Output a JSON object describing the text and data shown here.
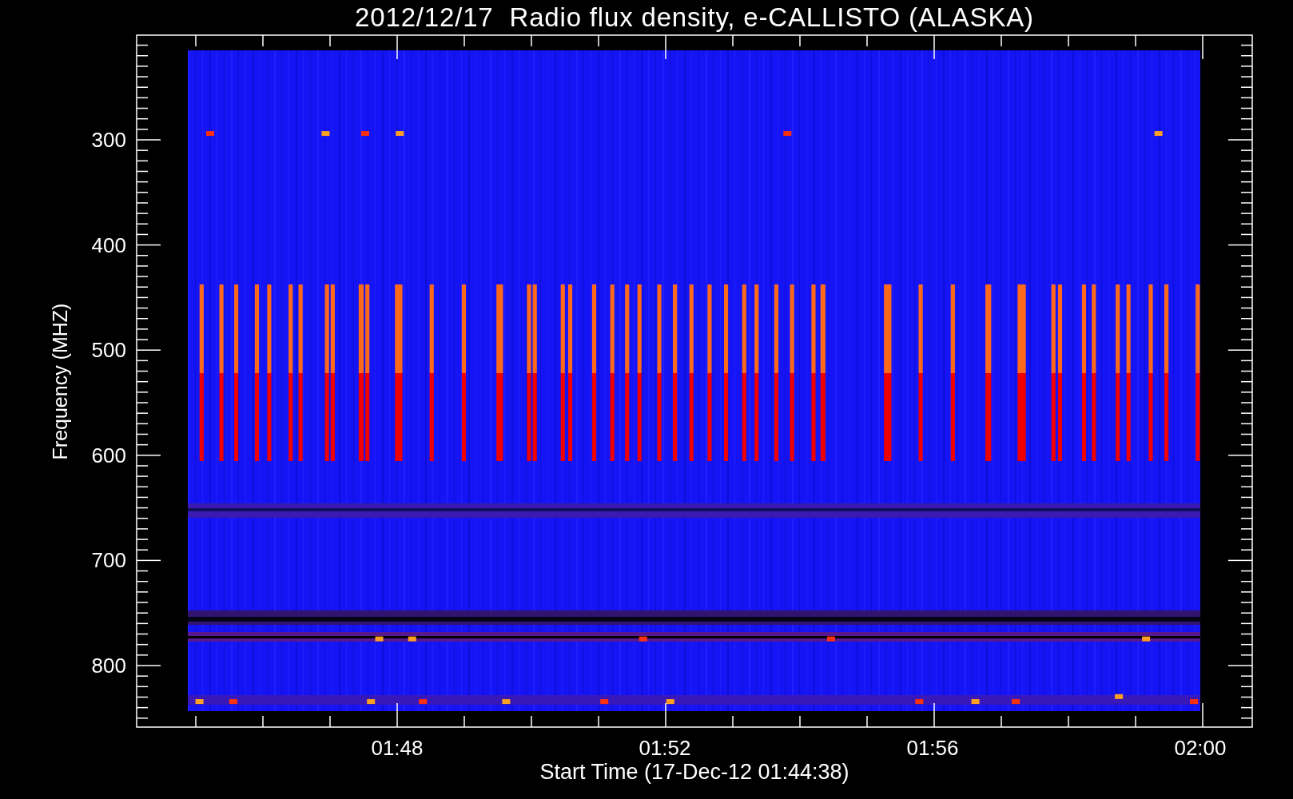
{
  "title": "2012/12/17  Radio flux density, e-CALLISTO (ALASKA)",
  "y_axis": {
    "label": "Frequency (MHZ)",
    "ticks": [
      "300",
      "400",
      "500",
      "600",
      "700",
      "800"
    ]
  },
  "x_axis": {
    "label": "Start Time (17-Dec-12 01:44:38)",
    "ticks": [
      "01:48",
      "01:52",
      "01:56",
      "02:00"
    ]
  }
}
